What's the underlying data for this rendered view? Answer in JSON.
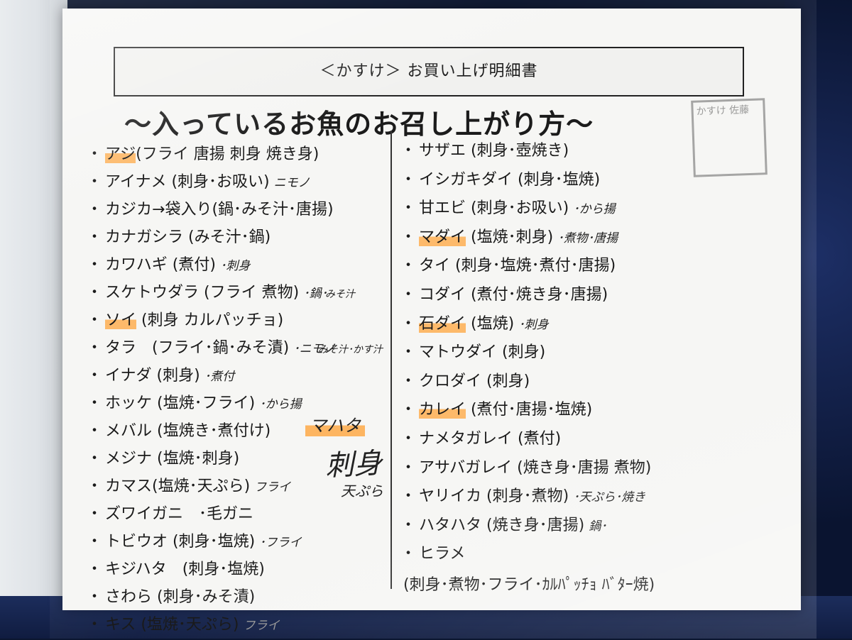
{
  "receipt_title": "＜かすけ＞ お買い上げ明細書",
  "main_title": "～入っているお魚のお召し上がり方～",
  "stamp_text": "かすけ 佐藤",
  "left_items": [
    {
      "fish": "アジ",
      "methods": "(フライ 唐揚 刺身 焼き身)",
      "note": "",
      "highlight": true
    },
    {
      "fish": "アイナメ",
      "methods": " (刺身･お吸い)",
      "note": "ニモノ",
      "highlight": false
    },
    {
      "fish": "カジカ",
      "methods": "→袋入り(鍋･みそ汁･唐揚)",
      "note": "",
      "highlight": false
    },
    {
      "fish": "カナガシラ",
      "methods": " (みそ汁･鍋)",
      "note": "",
      "highlight": false
    },
    {
      "fish": "カワハギ",
      "methods": " (煮付)",
      "note": "･刺身",
      "highlight": false
    },
    {
      "fish": "スケトウダラ",
      "methods": " (フライ 煮物)",
      "note": "･鍋･",
      "highlight": false
    },
    {
      "fish": "ソイ",
      "methods": " (刺身 カルパッチョ)",
      "note": "",
      "highlight": true
    },
    {
      "fish": "タラ",
      "methods": "　(フライ･鍋･みそ漬)",
      "note": "･ニモノ",
      "highlight": false
    },
    {
      "fish": "イナダ",
      "methods": " (刺身)",
      "note": "･煮付",
      "highlight": false
    },
    {
      "fish": "ホッケ",
      "methods": " (塩焼･フライ)",
      "note": "･から揚",
      "highlight": false
    },
    {
      "fish": "メバル",
      "methods": " (塩焼き･煮付け)",
      "note": "",
      "highlight": false
    },
    {
      "fish": "メジナ",
      "methods": " (塩焼･刺身)",
      "note": "",
      "highlight": false
    },
    {
      "fish": "カマス",
      "methods": "(塩焼･天ぷら)",
      "note": "フライ",
      "highlight": false
    },
    {
      "fish": "ズワイガニ",
      "methods": "　･毛ガニ",
      "note": "",
      "highlight": false
    },
    {
      "fish": "トビウオ",
      "methods": " (刺身･塩焼)",
      "note": "･フライ",
      "highlight": false
    },
    {
      "fish": "キジハタ",
      "methods": "　(刺身･塩焼)",
      "note": "",
      "highlight": false
    },
    {
      "fish": "さわら",
      "methods": " (刺身･みそ漬)",
      "note": "",
      "highlight": false
    },
    {
      "fish": "キス",
      "methods": " (塩焼･天ぷら)",
      "note": "フライ",
      "highlight": false
    }
  ],
  "right_items": [
    {
      "fish": "サザエ",
      "methods": " (刺身･壺焼き)",
      "note": "",
      "highlight": false
    },
    {
      "fish": "イシガキダイ",
      "methods": " (刺身･塩焼)",
      "note": "",
      "highlight": false
    },
    {
      "fish": "甘エビ",
      "methods": " (刺身･お吸い)",
      "note": "･から揚",
      "highlight": false
    },
    {
      "fish": "マダイ",
      "methods": " (塩焼･刺身)",
      "note": "･煮物･唐揚",
      "highlight": true
    },
    {
      "fish": "タイ",
      "methods": " (刺身･塩焼･煮付･唐揚)",
      "note": "",
      "highlight": false
    },
    {
      "fish": "コダイ",
      "methods": " (煮付･焼き身･唐揚)",
      "note": "",
      "highlight": false
    },
    {
      "fish": "石ダイ",
      "methods": " (塩焼)",
      "note": "･刺身",
      "highlight": true
    },
    {
      "fish": "マトウダイ",
      "methods": " (刺身)",
      "note": "",
      "highlight": false
    },
    {
      "fish": "クロダイ",
      "methods": " (刺身)",
      "note": "",
      "highlight": false
    },
    {
      "fish": "カレイ",
      "methods": " (煮付･唐揚･塩焼)",
      "note": "",
      "highlight": true
    },
    {
      "fish": "ナメタガレイ",
      "methods": " (煮付)",
      "note": "",
      "highlight": false
    },
    {
      "fish": "アサバガレイ",
      "methods": " (焼き身･唐揚 煮物)",
      "note": "",
      "highlight": false
    },
    {
      "fish": "ヤリイカ",
      "methods": " (刺身･煮物)",
      "note": "･天ぷら･焼き",
      "highlight": false
    },
    {
      "fish": "ハタハタ",
      "methods": " (焼き身･唐揚)",
      "note": "鍋･",
      "highlight": false
    },
    {
      "fish": "ヒラメ",
      "methods": "",
      "note": "",
      "highlight": false
    }
  ],
  "right_last_line": "(刺身･煮物･フライ･ｶﾙﾊﾟｯﾁｮ ﾊﾞﾀｰ焼)",
  "handwritten": {
    "sukeoudara_sub": "みそ汁",
    "tara_sub": "みそ汁･かす汁",
    "maha": "マハタ",
    "maha_sashimi": "刺身",
    "maha_tempura": "天ぷら"
  }
}
